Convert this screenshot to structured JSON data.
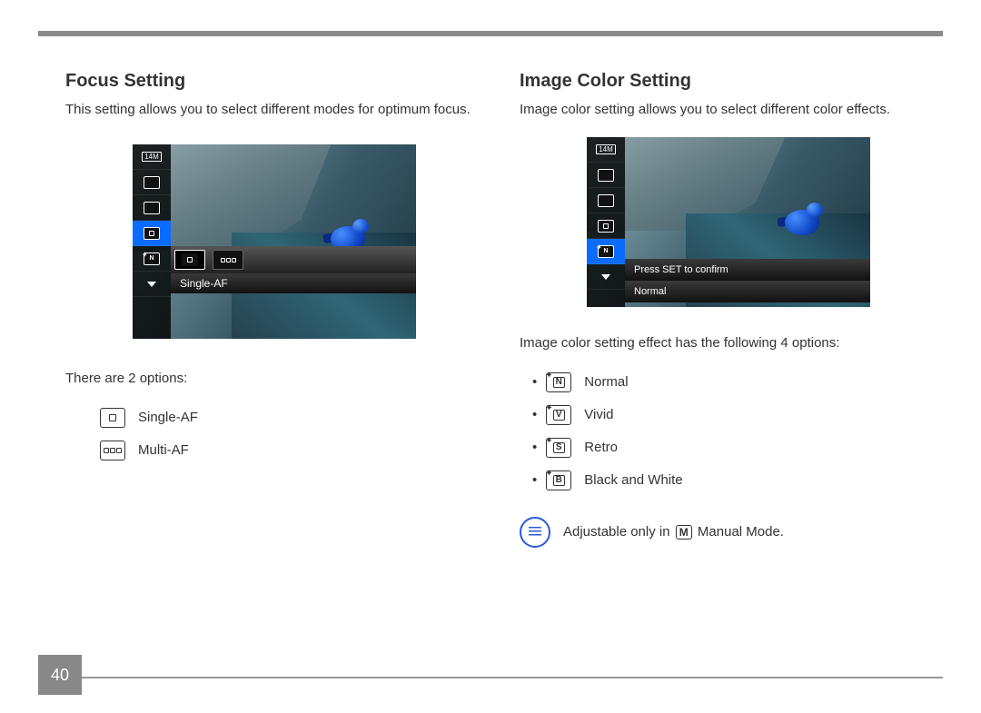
{
  "page_number": "40",
  "left": {
    "heading": "Focus Setting",
    "desc": "This setting allows you to select different modes for optimum focus.",
    "options_intro": "There are 2 options:",
    "options": [
      {
        "label": "Single-AF"
      },
      {
        "label": "Multi-AF"
      }
    ],
    "screen": {
      "sidebar_14m": "14M",
      "selected_label": "Single-AF"
    }
  },
  "right": {
    "heading": "Image Color Setting",
    "desc": "Image color setting allows you to select different color effects.",
    "options_intro": "Image color setting effect has the following 4 options:",
    "options": [
      {
        "letter": "N",
        "label": "Normal"
      },
      {
        "letter": "V",
        "label": "Vivid"
      },
      {
        "letter": "S",
        "label": "Retro"
      },
      {
        "letter": "B",
        "label": "Black and White"
      }
    ],
    "screen": {
      "sidebar_14m": "14M",
      "hint": "Press SET to confirm",
      "selected_label": "Normal"
    },
    "note_prefix": "Adjustable only in ",
    "note_mode_glyph": "M",
    "note_suffix": " Manual Mode."
  }
}
